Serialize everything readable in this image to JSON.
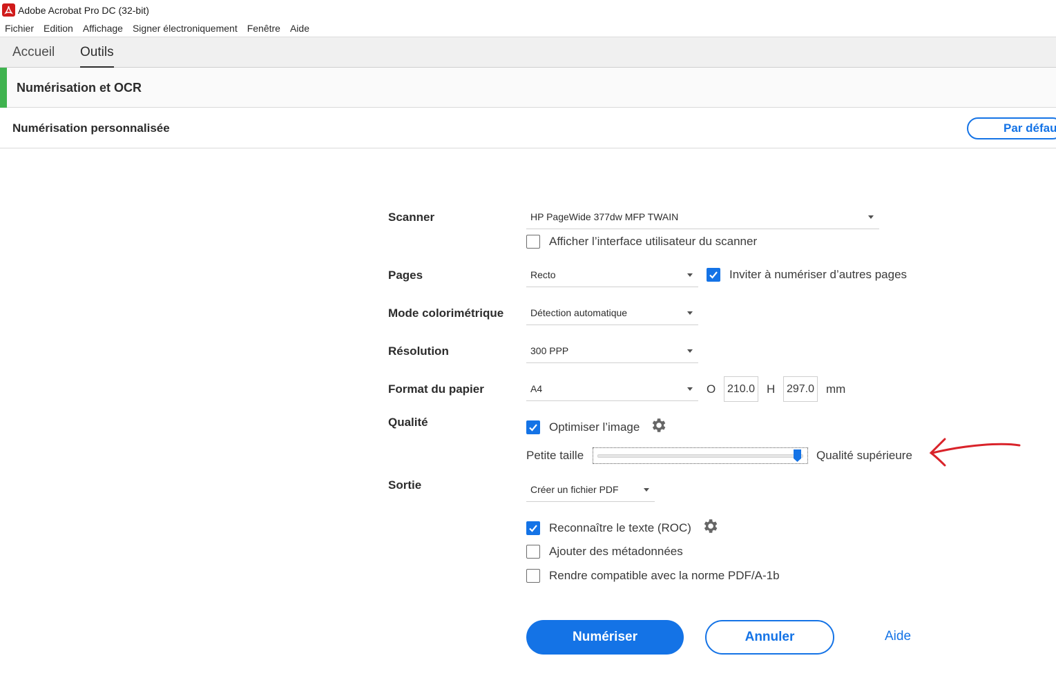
{
  "window": {
    "title": "Adobe Acrobat Pro DC (32-bit)",
    "icon": "acrobat-icon"
  },
  "menubar": {
    "items": [
      {
        "label": "Fichier"
      },
      {
        "label": "Edition"
      },
      {
        "label": "Affichage"
      },
      {
        "label": "Signer électroniquement"
      },
      {
        "label": "Fenêtre"
      },
      {
        "label": "Aide"
      }
    ]
  },
  "tabs": [
    {
      "label": "Accueil",
      "active": false
    },
    {
      "label": "Outils",
      "active": true
    }
  ],
  "tool": {
    "title": "Numérisation et OCR",
    "accent_color": "#3fb34f"
  },
  "subheader": {
    "title": "Numérisation personnalisée",
    "default_button": "Par défau"
  },
  "form": {
    "scanner": {
      "label": "Scanner",
      "value": "HP PageWide 377dw MFP TWAIN",
      "show_ui": {
        "label": "Afficher l’interface utilisateur du scanner",
        "checked": false
      }
    },
    "pages": {
      "label": "Pages",
      "value": "Recto",
      "prompt_more": {
        "label": "Inviter à numériser d’autres pages",
        "checked": true
      }
    },
    "color_mode": {
      "label": "Mode colorimétrique",
      "value": "Détection automatique"
    },
    "resolution": {
      "label": "Résolution",
      "value": "300 PPP"
    },
    "paper": {
      "label": "Format du papier",
      "value": "A4",
      "width_label": "O",
      "width": "210.0",
      "height_label": "H",
      "height": "297.0",
      "unit": "mm"
    },
    "quality": {
      "label": "Qualité",
      "optimize": {
        "label": "Optimiser l’image",
        "checked": true
      },
      "slider_min_label": "Petite taille",
      "slider_max_label": "Qualité supérieure",
      "slider_value": 1.0
    },
    "output": {
      "label": "Sortie",
      "value": "Créer un fichier PDF",
      "ocr": {
        "label": "Reconnaître le texte (ROC)",
        "checked": true
      },
      "metadata": {
        "label": "Ajouter des métadonnées",
        "checked": false
      },
      "pdfa": {
        "label": "Rendre compatible avec la norme PDF/A-1b",
        "checked": false
      }
    }
  },
  "actions": {
    "scan": "Numériser",
    "cancel": "Annuler",
    "help": "Aide"
  },
  "colors": {
    "accent": "#1473e6",
    "annotation": "#d9232a"
  }
}
